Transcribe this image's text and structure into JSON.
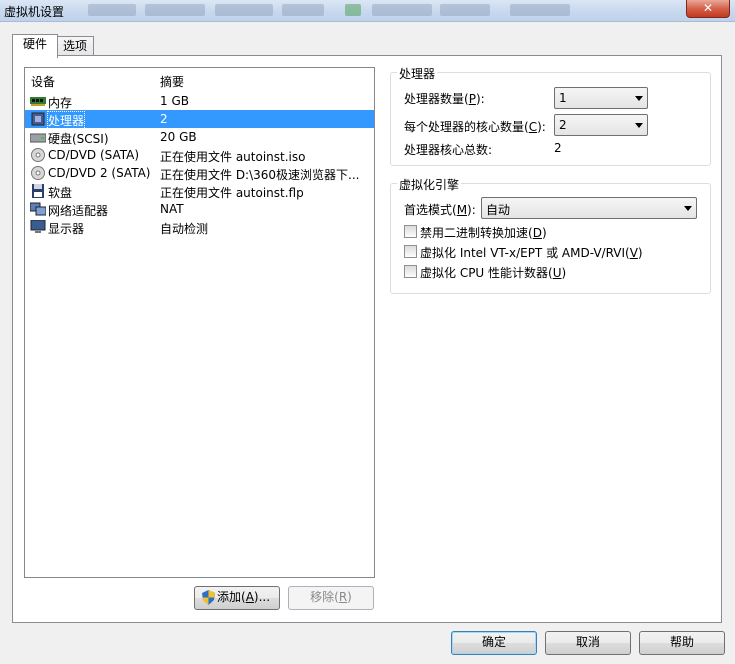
{
  "window": {
    "title": "虚拟机设置",
    "close_glyph": "✕"
  },
  "tabs": [
    {
      "label": "硬件",
      "active": true
    },
    {
      "label": "选项",
      "active": false
    }
  ],
  "device_list": {
    "header_device": "设备",
    "header_summary": "摘要",
    "items": [
      {
        "name": "内存",
        "summary": "1 GB",
        "icon": "memory-icon"
      },
      {
        "name": "处理器",
        "summary": "2",
        "icon": "processor-icon",
        "selected": true
      },
      {
        "name": "硬盘(SCSI)",
        "summary": "20 GB",
        "icon": "hard-disk-icon"
      },
      {
        "name": "CD/DVD (SATA)",
        "summary": "正在使用文件 autoinst.iso",
        "icon": "cd-dvd-icon"
      },
      {
        "name": "CD/DVD 2 (SATA)",
        "summary": "正在使用文件 D:\\360极速浏览器下...",
        "icon": "cd-dvd-icon"
      },
      {
        "name": "软盘",
        "summary": "正在使用文件 autoinst.flp",
        "icon": "floppy-icon"
      },
      {
        "name": "网络适配器",
        "summary": "NAT",
        "icon": "network-adapter-icon"
      },
      {
        "name": "显示器",
        "summary": "自动检测",
        "icon": "display-icon"
      }
    ],
    "add_label": "添加(",
    "add_key": "A",
    "add_suffix": ")...",
    "remove_label": "移除(",
    "remove_key": "R",
    "remove_suffix": ")"
  },
  "processor": {
    "group_title": "处理器",
    "count_label": "处理器数量(",
    "count_key": "P",
    "count_suffix": "):",
    "count_value": "1",
    "cores_label": "每个处理器的核心数量(",
    "cores_key": "C",
    "cores_suffix": "):",
    "cores_value": "2",
    "total_label": "处理器核心总数:",
    "total_value": "2"
  },
  "virtualization": {
    "group_title": "虚拟化引擎",
    "mode_label": "首选模式(",
    "mode_key": "M",
    "mode_suffix": "):",
    "mode_value": "自动",
    "opt1_label": "禁用二进制转换加速(",
    "opt1_key": "D",
    "opt1_suffix": ")",
    "opt2_label": "虚拟化 Intel VT-x/EPT 或 AMD-V/RVI(",
    "opt2_key": "V",
    "opt2_suffix": ")",
    "opt3_label": "虚拟化 CPU 性能计数器(",
    "opt3_key": "U",
    "opt3_suffix": ")"
  },
  "footer": {
    "ok": "确定",
    "cancel": "取消",
    "help": "帮助"
  }
}
